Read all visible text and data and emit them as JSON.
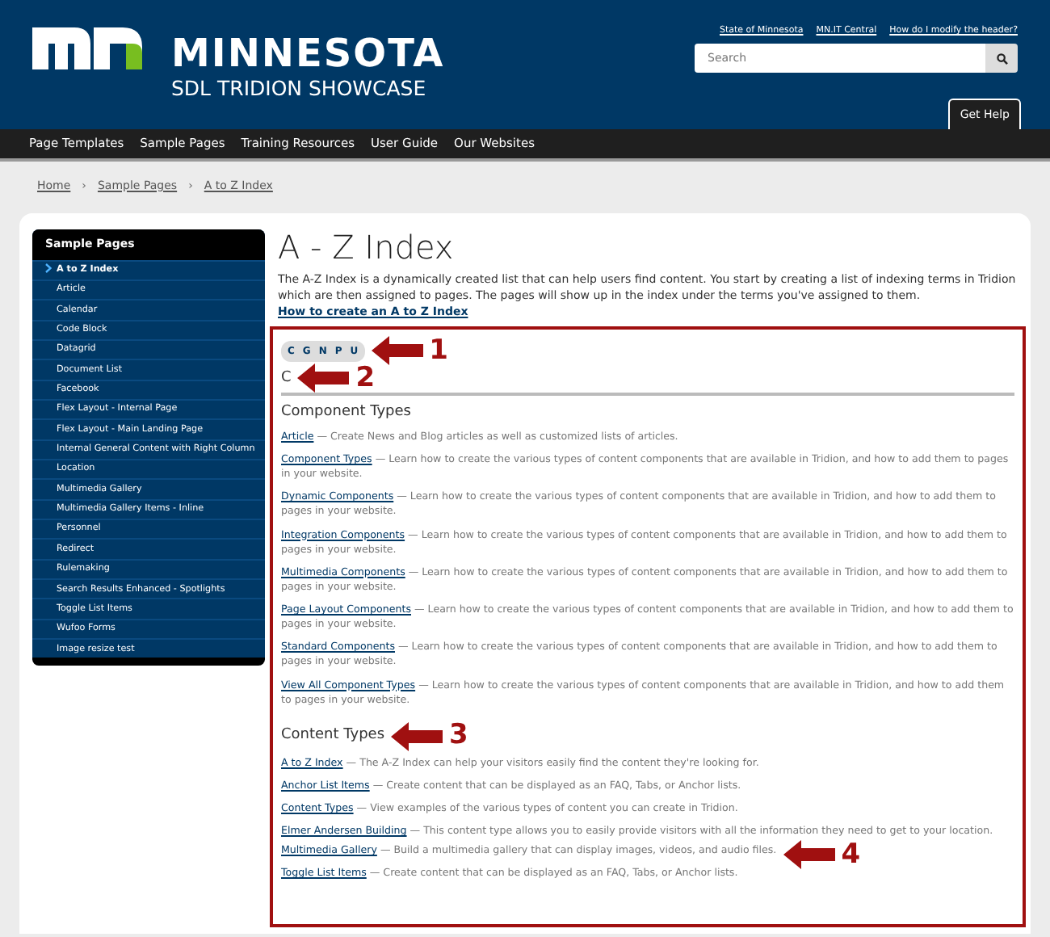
{
  "header": {
    "site_name": "MINNESOTA",
    "subtitle": "SDL TRIDION SHOWCASE",
    "utility_links": [
      "State of Minnesota",
      "MN.IT Central",
      "How do I modify the header?"
    ],
    "search": {
      "placeholder": "Search"
    },
    "help_tab": "Get Help"
  },
  "nav": [
    "Page Templates",
    "Sample Pages",
    "Training Resources",
    "User Guide",
    "Our Websites"
  ],
  "breadcrumb": {
    "separator": "›",
    "items": [
      "Home",
      "Sample Pages",
      "A to Z Index"
    ]
  },
  "sidebar": {
    "title": "Sample Pages",
    "items": [
      {
        "label": "A to Z Index",
        "selected": true
      },
      {
        "label": "Article",
        "selected": false
      },
      {
        "label": "Calendar",
        "selected": false
      },
      {
        "label": "Code Block",
        "selected": false
      },
      {
        "label": "Datagrid",
        "selected": false
      },
      {
        "label": "Document List",
        "selected": false
      },
      {
        "label": "Facebook",
        "selected": false
      },
      {
        "label": "Flex Layout - Internal Page",
        "selected": false
      },
      {
        "label": "Flex Layout - Main Landing Page",
        "selected": false
      },
      {
        "label": "Internal General Content with Right Column",
        "selected": false
      },
      {
        "label": "Location",
        "selected": false
      },
      {
        "label": "Multimedia Gallery",
        "selected": false
      },
      {
        "label": "Multimedia Gallery Items - Inline",
        "selected": false
      },
      {
        "label": "Personnel",
        "selected": false
      },
      {
        "label": "Redirect",
        "selected": false
      },
      {
        "label": "Rulemaking",
        "selected": false
      },
      {
        "label": "Search Results Enhanced - Spotlights",
        "selected": false
      },
      {
        "label": "Toggle List Items",
        "selected": false
      },
      {
        "label": "Wufoo Forms",
        "selected": false
      },
      {
        "label": "Image resize test",
        "selected": false
      }
    ]
  },
  "page": {
    "title": "A - Z Index",
    "intro": "The A-Z Index is a dynamically created list that can help users find content.  You start by creating a list of indexing terms in Tridion which are then assigned to pages.  The pages will show up in the index under the terms you've assigned to them.",
    "intro_link": "How to create an A to Z Index",
    "letters": {
      "items": [
        "C",
        "G",
        "N",
        "P",
        "U"
      ],
      "callout": "1"
    },
    "letter_heading": {
      "text": "C",
      "callout": "2"
    },
    "groups": [
      {
        "title": "Component Types",
        "entries": [
          {
            "link": "Article",
            "description": "— Create News and Blog articles as well as customized lists of articles."
          },
          {
            "link": "Component Types",
            "description": "— Learn how to create the various types of content components that are available in Tridion, and how to add them to pages in your website."
          },
          {
            "link": "Dynamic Components",
            "description": "— Learn how to create the various types of content components that are available in Tridion, and how to add them to pages in your website."
          },
          {
            "link": "Integration Components",
            "description": "— Learn how to create the various types of content components that are available in Tridion, and how to add them to pages in your website."
          },
          {
            "link": "Multimedia Components",
            "description": "— Learn how to create the various types of content components that are available in Tridion, and how to add them to pages in your website."
          },
          {
            "link": "Page Layout Components",
            "description": "— Learn how to create the various types of content components that are available in Tridion, and how to add them to pages in your website."
          },
          {
            "link": "Standard Components",
            "description": "— Learn how to create the various types of content components that are available in Tridion, and how to add them to pages in your website."
          },
          {
            "link": "View All Component Types",
            "description": "— Learn how to create the various types of content components that are available in Tridion, and how to add them to pages in your website."
          }
        ]
      },
      {
        "title": "Content Types",
        "callout": "3",
        "entries": [
          {
            "link": "A to Z Index",
            "description": "— The A-Z Index can help your visitors easily find the content they're looking for."
          },
          {
            "link": "Anchor List Items",
            "description": "— Create content that can be displayed as an FAQ, Tabs, or Anchor lists."
          },
          {
            "link": "Content Types",
            "description": "— View examples of the various types of content you can create in Tridion."
          },
          {
            "link": "Elmer Andersen Building",
            "description": "— This content type allows you to easily provide visitors with all the information they need to get to your location."
          },
          {
            "link": "Multimedia Gallery",
            "description": "— Build a multimedia gallery that can display images, videos, and audio files.",
            "callout": "4"
          },
          {
            "link": "Toggle List Items",
            "description": "— Create content that can be displayed as an FAQ, Tabs, or Anchor lists."
          }
        ]
      }
    ]
  }
}
